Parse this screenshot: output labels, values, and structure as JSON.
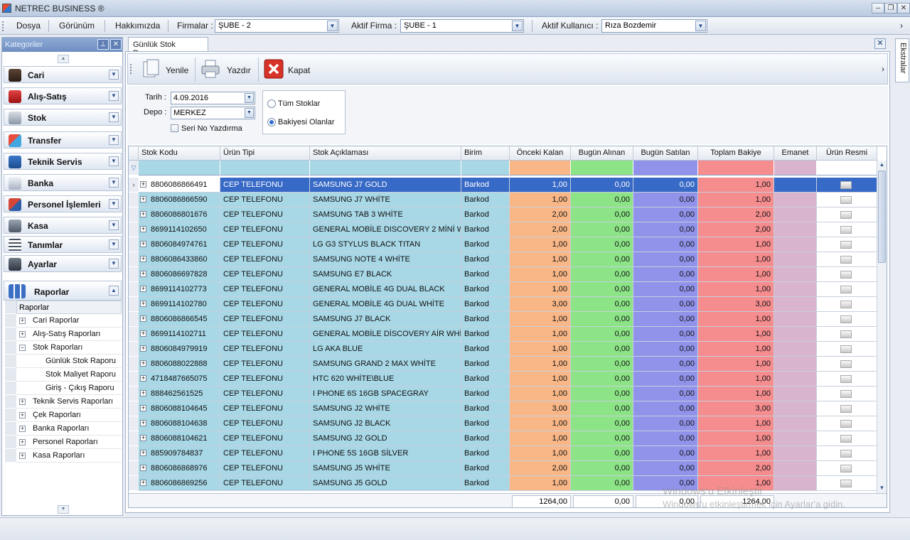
{
  "window": {
    "title": "NETREC BUSINESS ®"
  },
  "menu": {
    "items": [
      "Dosya",
      "Görünüm",
      "Hakkımızda"
    ],
    "firmalar_label": "Firmalar :",
    "firmalar_value": "ŞUBE - 2",
    "aktif_firma_label": "Aktif Firma :",
    "aktif_firma_value": "ŞUBE - 1",
    "aktif_kullanici_label": "Aktif Kullanıcı :",
    "aktif_kullanici_value": "Rıza Bozdemir"
  },
  "sidebar": {
    "title": "Kategoriler",
    "categories": [
      {
        "label": "Cari",
        "icon": "person-icon"
      },
      {
        "label": "Alış-Satış",
        "icon": "shopping-bag-icon"
      },
      {
        "label": "Stok",
        "icon": "boxes-icon"
      },
      {
        "label": "Transfer",
        "icon": "abc-transfer-icon"
      },
      {
        "label": "Teknik Servis",
        "icon": "tools-icon"
      },
      {
        "label": "Banka",
        "icon": "bank-icon"
      },
      {
        "label": "Personel İşlemleri",
        "icon": "staff-icon"
      },
      {
        "label": "Kasa",
        "icon": "safe-icon"
      },
      {
        "label": "Tanımlar",
        "icon": "list-icon"
      },
      {
        "label": "Ayarlar",
        "icon": "wrench-icon"
      },
      {
        "label": "Raporlar",
        "icon": "report-chart-icon"
      }
    ],
    "tree_header": "Raporlar",
    "tree": [
      {
        "label": "Cari Raporlar",
        "level": 1,
        "toggle": "+"
      },
      {
        "label": "Alış-Satış Raporları",
        "level": 1,
        "toggle": "+"
      },
      {
        "label": "Stok Raporları",
        "level": 1,
        "toggle": "-"
      },
      {
        "label": "Günlük Stok Raporu",
        "level": 2,
        "toggle": ""
      },
      {
        "label": "Stok Maliyet Raporu",
        "level": 2,
        "toggle": ""
      },
      {
        "label": "Giriş - Çıkış Raporu",
        "level": 2,
        "toggle": ""
      },
      {
        "label": "Teknik Servis Raporları",
        "level": 1,
        "toggle": "+"
      },
      {
        "label": "Çek Raporları",
        "level": 1,
        "toggle": "+"
      },
      {
        "label": "Banka Raporları",
        "level": 1,
        "toggle": "+"
      },
      {
        "label": "Personel Raporları",
        "level": 1,
        "toggle": "+"
      },
      {
        "label": "Kasa Raporları",
        "level": 1,
        "toggle": "+"
      }
    ]
  },
  "tab": {
    "label": "Günlük Stok Raporu"
  },
  "toolbar": {
    "yenile": "Yenile",
    "yazdir": "Yazdır",
    "kapat": "Kapat"
  },
  "filters": {
    "tarih_label": "Tarih :",
    "tarih_value": "4.09.2016",
    "depo_label": "Depo :",
    "depo_value": "MERKEZ",
    "seri_no_label": "Seri No Yazdırma",
    "radio_all": "Tüm Stoklar",
    "radio_balance": "Bakiyesi Olanlar",
    "selected_radio": "Bakiyesi Olanlar"
  },
  "grid": {
    "columns": [
      "Stok Kodu",
      "Ürün Tipi",
      "Stok Açıklaması",
      "Birim",
      "Önceki Kalan",
      "Bugün Alınan",
      "Bugün Satılan",
      "Toplam Bakiye",
      "Emanet",
      "Ürün Resmi"
    ],
    "colors": {
      "onceki": "#f9b787",
      "alinan": "#8ce487",
      "satilan": "#9192ea",
      "toplam": "#f58c8e",
      "emanet": "#d9b4cf",
      "text_bg": "#a8d7e6",
      "selected": "#3769c6"
    },
    "rows": [
      {
        "kod": "8806086866491",
        "tip": "CEP TELEFONU",
        "aciklama": "SAMSUNG J7 GOLD",
        "birim": "Barkod",
        "onceki": "1,00",
        "alinan": "0,00",
        "satilan": "0,00",
        "toplam": "1,00"
      },
      {
        "kod": "8806086866590",
        "tip": "CEP TELEFONU",
        "aciklama": "SAMSUNG J7 WHİTE",
        "birim": "Barkod",
        "onceki": "1,00",
        "alinan": "0,00",
        "satilan": "0,00",
        "toplam": "1,00"
      },
      {
        "kod": "8806086801676",
        "tip": "CEP TELEFONU",
        "aciklama": "SAMSUNG TAB 3 WHİTE",
        "birim": "Barkod",
        "onceki": "2,00",
        "alinan": "0,00",
        "satilan": "0,00",
        "toplam": "2,00"
      },
      {
        "kod": "8699114102650",
        "tip": "CEP TELEFONU",
        "aciklama": "GENERAL MOBİLE DISCOVERY 2 MİNİ W...",
        "birim": "Barkod",
        "onceki": "2,00",
        "alinan": "0,00",
        "satilan": "0,00",
        "toplam": "2,00"
      },
      {
        "kod": "8806084974761",
        "tip": "CEP TELEFONU",
        "aciklama": "LG G3 STYLUS BLACK TITAN",
        "birim": "Barkod",
        "onceki": "1,00",
        "alinan": "0,00",
        "satilan": "0,00",
        "toplam": "1,00"
      },
      {
        "kod": "8806086433860",
        "tip": "CEP TELEFONU",
        "aciklama": "SAMSUNG NOTE 4 WHİTE",
        "birim": "Barkod",
        "onceki": "1,00",
        "alinan": "0,00",
        "satilan": "0,00",
        "toplam": "1,00"
      },
      {
        "kod": "8806086697828",
        "tip": "CEP TELEFONU",
        "aciklama": "SAMSUNG E7 BLACK",
        "birim": "Barkod",
        "onceki": "1,00",
        "alinan": "0,00",
        "satilan": "0,00",
        "toplam": "1,00"
      },
      {
        "kod": "8699114102773",
        "tip": "CEP TELEFONU",
        "aciklama": "GENERAL MOBİLE 4G DUAL BLACK",
        "birim": "Barkod",
        "onceki": "1,00",
        "alinan": "0,00",
        "satilan": "0,00",
        "toplam": "1,00"
      },
      {
        "kod": "8699114102780",
        "tip": "CEP TELEFONU",
        "aciklama": "GENERAL MOBİLE 4G DUAL WHİTE",
        "birim": "Barkod",
        "onceki": "3,00",
        "alinan": "0,00",
        "satilan": "0,00",
        "toplam": "3,00"
      },
      {
        "kod": "8806086866545",
        "tip": "CEP TELEFONU",
        "aciklama": "SAMSUNG J7 BLACK",
        "birim": "Barkod",
        "onceki": "1,00",
        "alinan": "0,00",
        "satilan": "0,00",
        "toplam": "1,00"
      },
      {
        "kod": "8699114102711",
        "tip": "CEP TELEFONU",
        "aciklama": "GENERAL MOBİLE DİSCOVERY AİR WHİTE",
        "birim": "Barkod",
        "onceki": "1,00",
        "alinan": "0,00",
        "satilan": "0,00",
        "toplam": "1,00"
      },
      {
        "kod": "8806084979919",
        "tip": "CEP TELEFONU",
        "aciklama": "LG AKA BLUE",
        "birim": "Barkod",
        "onceki": "1,00",
        "alinan": "0,00",
        "satilan": "0,00",
        "toplam": "1,00"
      },
      {
        "kod": "8806088022888",
        "tip": "CEP TELEFONU",
        "aciklama": "SAMSUNG GRAND 2 MAX WHİTE",
        "birim": "Barkod",
        "onceki": "1,00",
        "alinan": "0,00",
        "satilan": "0,00",
        "toplam": "1,00"
      },
      {
        "kod": "4718487665075",
        "tip": "CEP TELEFONU",
        "aciklama": "HTC 620 WHİTE\\BLUE",
        "birim": "Barkod",
        "onceki": "1,00",
        "alinan": "0,00",
        "satilan": "0,00",
        "toplam": "1,00"
      },
      {
        "kod": "888462561525",
        "tip": "CEP TELEFONU",
        "aciklama": "I PHONE 6S 16GB SPACEGRAY",
        "birim": "Barkod",
        "onceki": "1,00",
        "alinan": "0,00",
        "satilan": "0,00",
        "toplam": "1,00"
      },
      {
        "kod": "8806088104645",
        "tip": "CEP TELEFONU",
        "aciklama": "SAMSUNG J2 WHİTE",
        "birim": "Barkod",
        "onceki": "3,00",
        "alinan": "0,00",
        "satilan": "0,00",
        "toplam": "3,00"
      },
      {
        "kod": "8806088104638",
        "tip": "CEP TELEFONU",
        "aciklama": "SAMSUNG J2 BLACK",
        "birim": "Barkod",
        "onceki": "1,00",
        "alinan": "0,00",
        "satilan": "0,00",
        "toplam": "1,00"
      },
      {
        "kod": "8806088104621",
        "tip": "CEP TELEFONU",
        "aciklama": "SAMSUNG J2 GOLD",
        "birim": "Barkod",
        "onceki": "1,00",
        "alinan": "0,00",
        "satilan": "0,00",
        "toplam": "1,00"
      },
      {
        "kod": "885909784837",
        "tip": "CEP TELEFONU",
        "aciklama": "I PHONE 5S 16GB SİLVER",
        "birim": "Barkod",
        "onceki": "1,00",
        "alinan": "0,00",
        "satilan": "0,00",
        "toplam": "1,00"
      },
      {
        "kod": "8806086868976",
        "tip": "CEP TELEFONU",
        "aciklama": "SAMSUNG J5 WHİTE",
        "birim": "Barkod",
        "onceki": "2,00",
        "alinan": "0,00",
        "satilan": "0,00",
        "toplam": "2,00"
      },
      {
        "kod": "8806086869256",
        "tip": "CEP TELEFONU",
        "aciklama": "SAMSUNG J5 GOLD",
        "birim": "Barkod",
        "onceki": "1,00",
        "alinan": "0,00",
        "satilan": "0,00",
        "toplam": "1,00"
      }
    ],
    "totals": {
      "onceki": "1264,00",
      "alinan": "0,00",
      "satilan": "0,00",
      "toplam": "1264,00"
    }
  },
  "right_tab": {
    "label": "Ekstralar"
  },
  "watermark": {
    "line1": "Windows'u Etkinleştir",
    "line2": "Windows'u etkinleştirmek için Ayarlar'a gidin."
  }
}
